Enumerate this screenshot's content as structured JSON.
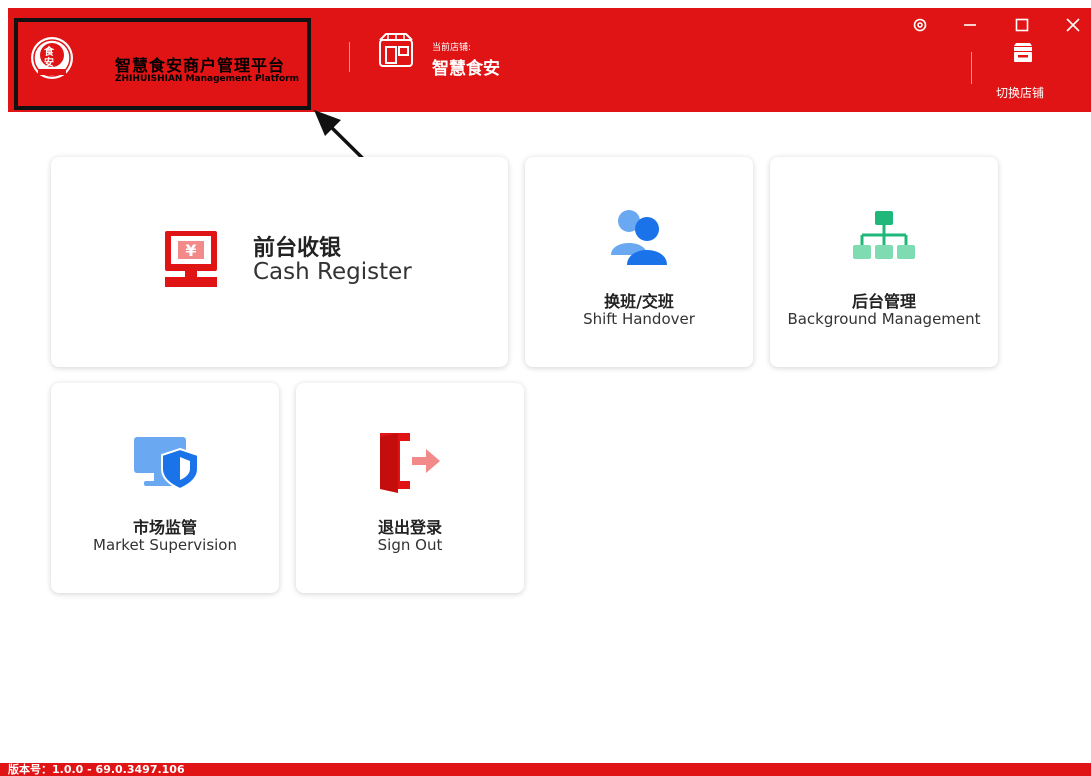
{
  "header": {
    "brand_title": "智慧食安商户管理平台",
    "brand_subtitle": "ZHIHUISHIAN Management Platform",
    "badge_top": "食",
    "badge_bottom": "安",
    "store_caption": "当前店铺:",
    "store_name": "智慧食安",
    "switch_store_label": "切换店铺"
  },
  "tiles": {
    "cash_register": {
      "zh": "前台收银",
      "en": "Cash Register"
    },
    "shift_handover": {
      "zh": "换班/交班",
      "en": "Shift Handover"
    },
    "background_management": {
      "zh": "后台管理",
      "en": "Background Management"
    },
    "market_supervision": {
      "zh": "市场监管",
      "en": "Market Supervision"
    },
    "sign_out": {
      "zh": "退出登录",
      "en": "Sign Out"
    }
  },
  "icons": {
    "settings": "gear-icon",
    "minimize": "minimize-icon",
    "maximize": "maximize-icon",
    "close": "close-icon"
  },
  "footer": {
    "version": "版本号：1.0.0 - 69.0.3497.106"
  },
  "colors": {
    "brand_red": "#e01414",
    "blue": "#1a73e8",
    "green": "#3ccb8f"
  }
}
